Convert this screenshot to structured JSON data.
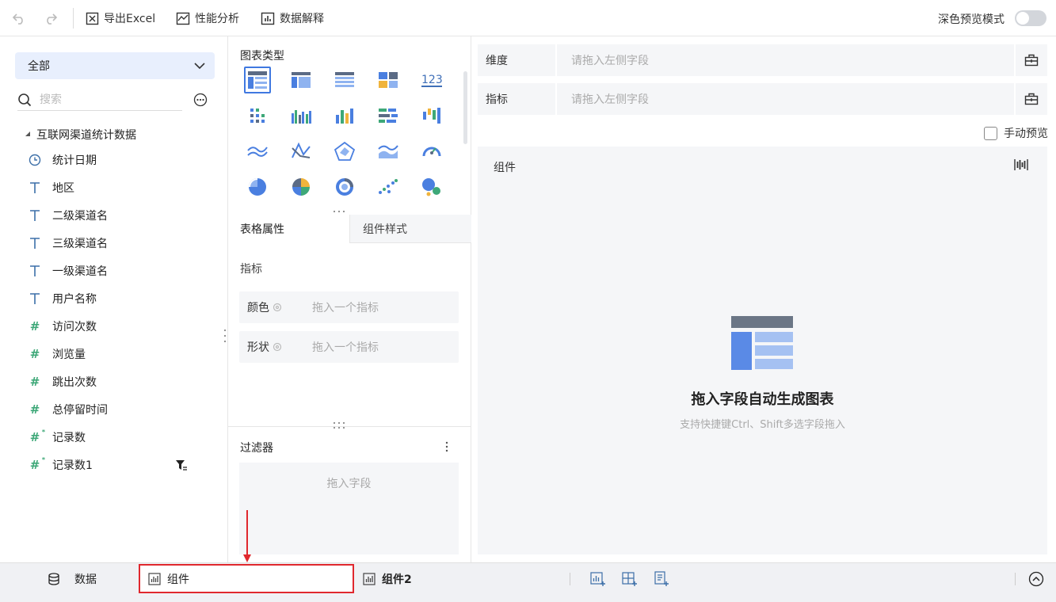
{
  "toolbar": {
    "export_label": "导出Excel",
    "perf_label": "性能分析",
    "explain_label": "数据解释",
    "dark_mode_label": "深色预览模式"
  },
  "data_panel": {
    "dataset_select": "全部",
    "search_placeholder": "搜索",
    "table_name": "互联网渠道统计数据",
    "fields": [
      {
        "type": "date",
        "name": "统计日期"
      },
      {
        "type": "text",
        "name": "地区"
      },
      {
        "type": "text",
        "name": "二级渠道名"
      },
      {
        "type": "text",
        "name": "三级渠道名"
      },
      {
        "type": "text",
        "name": "一级渠道名"
      },
      {
        "type": "text",
        "name": "用户名称"
      },
      {
        "type": "number",
        "name": "访问次数"
      },
      {
        "type": "number",
        "name": "浏览量"
      },
      {
        "type": "number",
        "name": "跳出次数"
      },
      {
        "type": "number",
        "name": "总停留时间"
      },
      {
        "type": "calc",
        "name": "记录数"
      },
      {
        "type": "calc",
        "name": "记录数1"
      }
    ]
  },
  "config_panel": {
    "chart_type_title": "图表类型",
    "tab_table_props": "表格属性",
    "tab_component_style": "组件样式",
    "metric_label": "指标",
    "color_label": "颜色",
    "color_placeholder": "拖入一个指标",
    "shape_label": "形状",
    "shape_placeholder": "拖入一个指标",
    "filter_title": "过滤器",
    "filter_placeholder": "拖入字段"
  },
  "canvas_panel": {
    "dimension_label": "维度",
    "dimension_placeholder": "请拖入左侧字段",
    "metric_label": "指标",
    "metric_placeholder": "请拖入左侧字段",
    "manual_preview_label": "手动预览",
    "component_title": "组件",
    "empty_title": "拖入字段自动生成图表",
    "empty_subtitle": "支持快捷键Ctrl、Shift多选字段拖入"
  },
  "bottom_bar": {
    "data_tab": "数据",
    "component_tab": "组件",
    "component2_tab": "组件2"
  },
  "colors": {
    "accent": "#3f78e0",
    "number_field": "#3ea878",
    "highlight_box": "#e0282e"
  }
}
